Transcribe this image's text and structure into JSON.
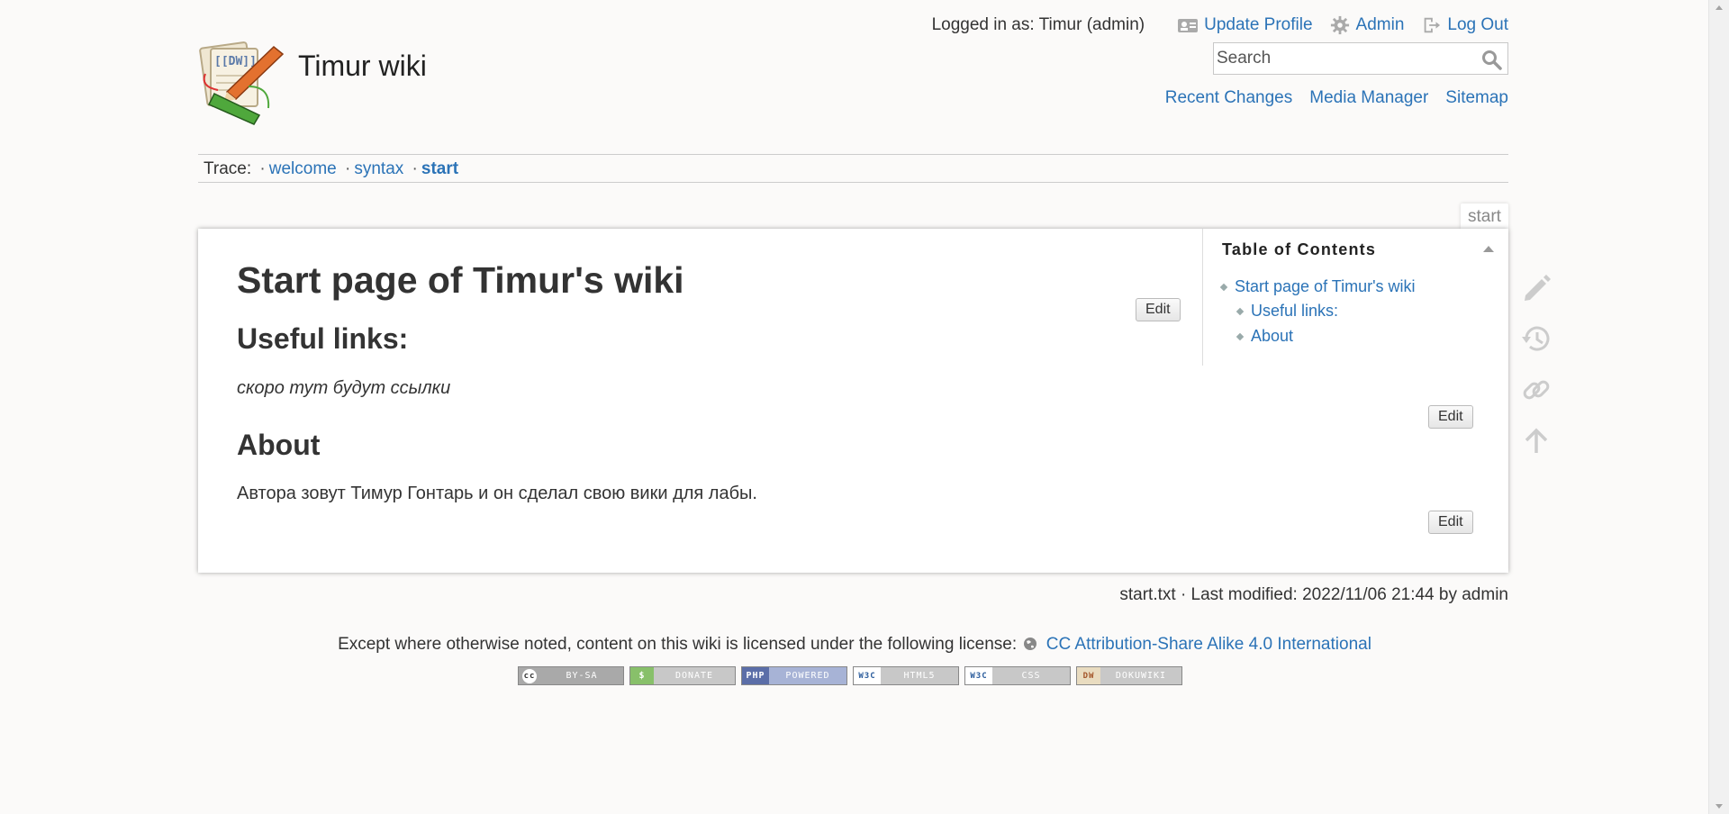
{
  "site": {
    "title": "Timur wiki"
  },
  "user_bar": {
    "logged_in_text": "Logged in as: Timur (admin)",
    "update_profile": "Update Profile",
    "admin": "Admin",
    "logout": "Log Out"
  },
  "search": {
    "placeholder": "Search",
    "value": ""
  },
  "site_tools": {
    "recent_changes": "Recent Changes",
    "media_manager": "Media Manager",
    "sitemap": "Sitemap"
  },
  "trace": {
    "label": "Trace:",
    "items": [
      "welcome",
      "syntax",
      "start"
    ]
  },
  "page": {
    "tab_name": "start",
    "h1": "Start page of Timur's wiki",
    "h2_links": "Useful links:",
    "links_text": "скоро тут будут ссылки",
    "h2_about": "About",
    "about_text": "Автора зовут Тимур Гонтарь и он сделал свою вики для лабы.",
    "edit_label": "Edit"
  },
  "toc": {
    "title": "Table of Contents",
    "items": [
      "Start page of Timur's wiki",
      "Useful links:",
      "About"
    ]
  },
  "page_tools": [
    "pencil-icon",
    "history-icon",
    "link-icon",
    "arrow-up-icon"
  ],
  "doc_info": "start.txt · Last modified: 2022/11/06 21:44 by admin",
  "license": {
    "prefix": "Except where otherwise noted, content on this wiki is licensed under the following license:",
    "link": "CC Attribution-Share Alike 4.0 International"
  },
  "badges": [
    {
      "left": "cc",
      "right": "BY-SA",
      "color": "#aaaaaa"
    },
    {
      "left": "$",
      "right": "DONATE",
      "color": "#88c06a"
    },
    {
      "left": "PHP",
      "right": "POWERED",
      "color": "#7b8ec8"
    },
    {
      "left": "W3C",
      "right": "HTML5",
      "color": "#b9b9b9"
    },
    {
      "left": "W3C",
      "right": "CSS",
      "color": "#b9b9b9"
    },
    {
      "left": "DW",
      "right": "DOKUWIKI",
      "color": "#b9b9b9"
    }
  ],
  "colors": {
    "link": "#2b73b7",
    "text": "#333333",
    "background": "#fbfaf9"
  }
}
